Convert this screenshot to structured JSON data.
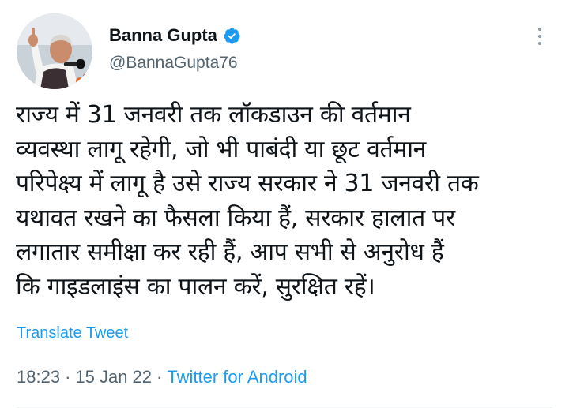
{
  "author": {
    "display_name": "Banna Gupta",
    "handle": "@BannaGupta76",
    "verified": true
  },
  "tweet": {
    "text_lines": [
      "राज्य में 31 जनवरी तक लॉकडाउन की वर्तमान",
      "व्यवस्था लागू रहेगी, जो भी पाबंदी या छूट वर्तमान",
      "परिपेक्ष्य में लागू है उसे राज्य सरकार ने 31 जनवरी तक",
      "यथावत रखने का फैसला किया हैं, सरकार हालात पर",
      "लगातार समीक्षा कर रही हैं, आप सभी से अनुरोध हैं",
      "कि गाइडलाइंस का पालन करें, सुरक्षित रहें।"
    ],
    "translate_label": "Translate Tweet",
    "time": "18:23",
    "date": "15 Jan 22",
    "source": "Twitter for Android",
    "separator": "·"
  },
  "icons": {
    "verified": "verified-badge-icon",
    "more": "more-options-icon"
  },
  "colors": {
    "accent": "#1d9bf0",
    "text_primary": "#0f1419",
    "text_secondary": "#536471"
  }
}
